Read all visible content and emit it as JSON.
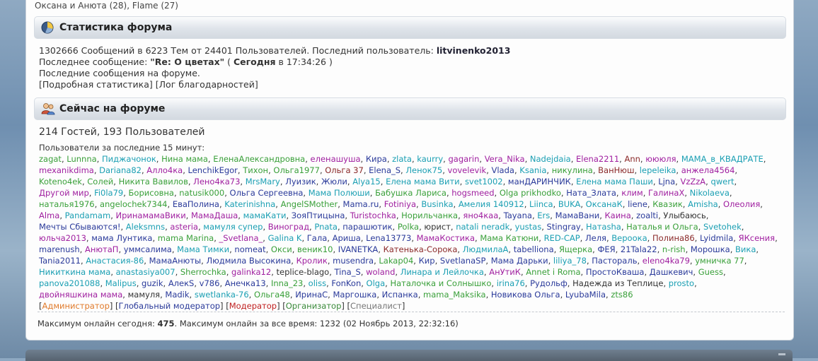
{
  "top_line": "Оксана и Анюта (28), Flame (27)",
  "stats_section": {
    "title": "Статистика форума",
    "icon": "pie-chart-icon",
    "line1_prefix": "1302666 Сообщений в 6223 Тем от 24401 Пользователей. Последний пользователь: ",
    "last_user": "litvinenko2013",
    "line2_prefix": "Последнее сообщение: ",
    "last_message": "\"Re: О цветах\"",
    "line2_mid": " ( ",
    "last_message_time_bold": "Сегодня",
    "line2_suffix": " в 17:34:26 )",
    "line3": "Последние сообщения на форуме.",
    "line4_link1": "[Подробная статистика]",
    "line4_link2": "[Лог благодарностей]"
  },
  "online_section": {
    "title": "Сейчас на форуме",
    "icon": "users-icon",
    "counts": "214 Гостей, 193 Пользователей",
    "users_label": "Пользователи за последние 15 минут:",
    "users": [
      {
        "n": "zagat",
        "c": "#3aa03a"
      },
      {
        "n": "Lunnna",
        "c": "#3aa03a"
      },
      {
        "n": "Пиджачонок",
        "c": "#1a9fb3"
      },
      {
        "n": "Нина мама",
        "c": "#3aa03a"
      },
      {
        "n": "ЕленаАлександровна",
        "c": "#3aa03a"
      },
      {
        "n": "еленашуша",
        "c": "#a020a0"
      },
      {
        "n": "Кира",
        "c": "#2a3a9a"
      },
      {
        "n": "zlata",
        "c": "#1a9fb3"
      },
      {
        "n": "kaurry",
        "c": "#1a9fb3"
      },
      {
        "n": "gagarin",
        "c": "#a020a0"
      },
      {
        "n": "Vera_Nika",
        "c": "#a020a0"
      },
      {
        "n": "Nadejdaia",
        "c": "#1a9fb3"
      },
      {
        "n": "Elena2211",
        "c": "#a020a0"
      },
      {
        "n": "Ann",
        "c": "#8b2a2a"
      },
      {
        "n": "юююля",
        "c": "#a020a0"
      },
      {
        "n": "МАМА_в_КВАДРАТЕ",
        "c": "#1a9fb3"
      },
      {
        "n": "mexanikdima",
        "c": "#a020a0"
      },
      {
        "n": "Dariana82",
        "c": "#1a9fb3"
      },
      {
        "n": "Алло4ка",
        "c": "#a020a0"
      },
      {
        "n": "LenchikEgor",
        "c": "#2a3a9a"
      },
      {
        "n": "Тихон",
        "c": "#3aa03a"
      },
      {
        "n": "Ольга1977",
        "c": "#3aa03a"
      },
      {
        "n": "Ольга 37",
        "c": "#8b2a2a"
      },
      {
        "n": "Elena_S",
        "c": "#2a3a9a"
      },
      {
        "n": "Ленок75",
        "c": "#1a9fb3"
      },
      {
        "n": "vovelevik",
        "c": "#a020a0"
      },
      {
        "n": "Vlada",
        "c": "#2a3a9a"
      },
      {
        "n": "Ksania",
        "c": "#1a9fb3"
      },
      {
        "n": "никулина",
        "c": "#3aa03a"
      },
      {
        "n": "ВанНюш",
        "c": "#8b2a2a"
      },
      {
        "n": "lepeleika",
        "c": "#1a9fb3"
      },
      {
        "n": "анжела4564",
        "c": "#a020a0"
      },
      {
        "n": "Koteno4ek",
        "c": "#3aa03a"
      },
      {
        "n": "Солей",
        "c": "#3aa03a"
      },
      {
        "n": "Никита Вавилов",
        "c": "#3aa03a"
      },
      {
        "n": "Лено4ка73",
        "c": "#a020a0"
      },
      {
        "n": "MrsMary",
        "c": "#1a9fb3"
      },
      {
        "n": "Луизик",
        "c": "#2a3a9a"
      },
      {
        "n": "Жюли",
        "c": "#2a3a9a"
      },
      {
        "n": "Alya15",
        "c": "#1a9fb3"
      },
      {
        "n": "Елена мама Вити",
        "c": "#1a9fb3"
      },
      {
        "n": "svet1002",
        "c": "#1a9fb3"
      },
      {
        "n": "манДАРИНЧИК",
        "c": "#2a3a9a"
      },
      {
        "n": "Елена мама Паши",
        "c": "#1a9fb3"
      },
      {
        "n": "Ljna",
        "c": "#2a3a9a"
      },
      {
        "n": "VzZzA",
        "c": "#a020a0"
      },
      {
        "n": "qwert",
        "c": "#1a9fb3"
      },
      {
        "n": "Другой мир",
        "c": "#a020a0"
      },
      {
        "n": "Fi0la79",
        "c": "#1a9fb3"
      },
      {
        "n": "Борисовна",
        "c": "#3aa03a"
      },
      {
        "n": "natusik000",
        "c": "#3aa03a"
      },
      {
        "n": "Ольга Сергеевна",
        "c": "#2a3a9a"
      },
      {
        "n": "Мама Полюши",
        "c": "#1a9fb3"
      },
      {
        "n": "Бабушка Лариса",
        "c": "#3aa03a"
      },
      {
        "n": "hogsmeed",
        "c": "#a020a0"
      },
      {
        "n": "Olga prikhodko",
        "c": "#3aa03a"
      },
      {
        "n": "Ната_Злата",
        "c": "#2a3a9a"
      },
      {
        "n": "клим",
        "c": "#a020a0"
      },
      {
        "n": "ГалинаХ",
        "c": "#a020a0"
      },
      {
        "n": "Nikolaeva",
        "c": "#1a9fb3"
      },
      {
        "n": "наталья1976",
        "c": "#3aa03a"
      },
      {
        "n": "angelochek7344",
        "c": "#3aa03a"
      },
      {
        "n": "ЕваПолина",
        "c": "#2a3a9a"
      },
      {
        "n": "Katerinishna",
        "c": "#1a9fb3"
      },
      {
        "n": "AngelSMother",
        "c": "#3aa03a"
      },
      {
        "n": "Mama.ru",
        "c": "#2a3a9a"
      },
      {
        "n": "Fotiniya",
        "c": "#a020a0"
      },
      {
        "n": "Businka",
        "c": "#1a9fb3"
      },
      {
        "n": "Амелия 140912",
        "c": "#1a9fb3"
      },
      {
        "n": "Liinca",
        "c": "#1a9fb3"
      },
      {
        "n": "BUKA",
        "c": "#1a9fb3"
      },
      {
        "n": "ОксанаК",
        "c": "#1a9fb3"
      },
      {
        "n": "liene",
        "c": "#2a3a9a"
      },
      {
        "n": "Квазик",
        "c": "#3aa03a"
      },
      {
        "n": "Amisha",
        "c": "#1a9fb3"
      },
      {
        "n": "Олеолия",
        "c": "#a020a0"
      },
      {
        "n": "Alma",
        "c": "#a020a0"
      },
      {
        "n": "Pandamam",
        "c": "#1a9fb3"
      },
      {
        "n": "ИринамамаВики",
        "c": "#a020a0"
      },
      {
        "n": "МамаДаша",
        "c": "#a020a0"
      },
      {
        "n": "мамаКати",
        "c": "#1a9fb3"
      },
      {
        "n": "ЗояПтицына",
        "c": "#2a3a9a"
      },
      {
        "n": "Turistochka",
        "c": "#a020a0"
      },
      {
        "n": "Норильчанка",
        "c": "#3aa03a"
      },
      {
        "n": "яно4каа",
        "c": "#a020a0"
      },
      {
        "n": "Tayana",
        "c": "#2a3a9a"
      },
      {
        "n": "Ers",
        "c": "#1a9fb3"
      },
      {
        "n": "МамаВани",
        "c": "#2a3a9a"
      },
      {
        "n": "Каина",
        "c": "#a020a0"
      },
      {
        "n": "zoalti",
        "c": "#2a3a9a"
      },
      {
        "n": "Улыбаюсь",
        "c": "#333333"
      },
      {
        "n": "Мечты Сбываются!",
        "c": "#2a3a9a"
      },
      {
        "n": "Aleksmns",
        "c": "#1a9fb3"
      },
      {
        "n": "asteria",
        "c": "#a020a0"
      },
      {
        "n": "мамуля супер",
        "c": "#1a9fb3"
      },
      {
        "n": "Виноград",
        "c": "#a020a0"
      },
      {
        "n": "Pnata",
        "c": "#1a9fb3"
      },
      {
        "n": "парашютик",
        "c": "#2a3a9a"
      },
      {
        "n": "Polka",
        "c": "#3aa03a"
      },
      {
        "n": "юрист",
        "c": "#333333"
      },
      {
        "n": "natali neradk",
        "c": "#1a9fb3"
      },
      {
        "n": "yustas",
        "c": "#1a9fb3"
      },
      {
        "n": "Stingray",
        "c": "#2a3a9a"
      },
      {
        "n": "Натаsha",
        "c": "#1a9fb3"
      },
      {
        "n": "Наталья и Ольга",
        "c": "#3aa03a"
      },
      {
        "n": "Svetohek",
        "c": "#1a9fb3"
      },
      {
        "n": "юльча2013",
        "c": "#a020a0"
      },
      {
        "n": "мама Лунтика",
        "c": "#2a3a9a"
      },
      {
        "n": "mama Marina",
        "c": "#3aa03a"
      },
      {
        "n": "_Svetlana_",
        "c": "#a020a0"
      },
      {
        "n": "Galina K",
        "c": "#1a9fb3"
      },
      {
        "n": "Гала",
        "c": "#2a3a9a"
      },
      {
        "n": "Ариша",
        "c": "#2a3a9a"
      },
      {
        "n": "Lena13773",
        "c": "#2a3a9a"
      },
      {
        "n": "МамаКостика",
        "c": "#a020a0"
      },
      {
        "n": "Мама Катюни",
        "c": "#3aa03a"
      },
      {
        "n": "RED-CAP",
        "c": "#1a9fb3"
      },
      {
        "n": "Леля",
        "c": "#2a3a9a"
      },
      {
        "n": "Вероока",
        "c": "#1a9fb3"
      },
      {
        "n": "Полина86",
        "c": "#8b2a2a"
      },
      {
        "n": "Lyidmila",
        "c": "#2a3a9a"
      },
      {
        "n": "ЯКсения",
        "c": "#a020a0"
      },
      {
        "n": "marenush",
        "c": "#2a3a9a"
      },
      {
        "n": "АнютаП",
        "c": "#a020a0"
      },
      {
        "n": "уммсалима",
        "c": "#2a3a9a"
      },
      {
        "n": "Мама Тимки",
        "c": "#1a9fb3"
      },
      {
        "n": "nomeat",
        "c": "#2a3a9a"
      },
      {
        "n": "Окси",
        "c": "#3aa03a"
      },
      {
        "n": "веник10",
        "c": "#3aa03a"
      },
      {
        "n": "IVANETKA",
        "c": "#2a3a9a"
      },
      {
        "n": "Катенька-Сорока",
        "c": "#8b2a2a"
      },
      {
        "n": "ЛюдмилаА",
        "c": "#1a9fb3"
      },
      {
        "n": "tabelliona",
        "c": "#2a3a9a"
      },
      {
        "n": "Ящерка",
        "c": "#3aa03a"
      },
      {
        "n": "ФЕЯ",
        "c": "#2a3a9a"
      },
      {
        "n": "21Tala22",
        "c": "#2a3a9a"
      },
      {
        "n": "n-rish",
        "c": "#3aa03a"
      },
      {
        "n": "Морошка",
        "c": "#2a3a9a"
      },
      {
        "n": "Вика",
        "c": "#1a9fb3"
      },
      {
        "n": "Tania2011",
        "c": "#2a3a9a"
      },
      {
        "n": "Анастасия-86",
        "c": "#1a9fb3"
      },
      {
        "n": "МамаАнюты",
        "c": "#2a3a9a"
      },
      {
        "n": "Людмила Высокина",
        "c": "#2a3a9a"
      },
      {
        "n": "Кролик",
        "c": "#a020a0"
      },
      {
        "n": "musendra",
        "c": "#2a3a9a"
      },
      {
        "n": "Lakap04",
        "c": "#3aa03a"
      },
      {
        "n": "Кир",
        "c": "#2a3a9a"
      },
      {
        "n": "SvetlanaSP",
        "c": "#2a3a9a"
      },
      {
        "n": "Мама Дарьки",
        "c": "#2a3a9a"
      },
      {
        "n": "liliya_78",
        "c": "#1a9fb3"
      },
      {
        "n": "Пастораль",
        "c": "#2a3a9a"
      },
      {
        "n": "eleno4ka79",
        "c": "#a020a0"
      },
      {
        "n": "умничка 77",
        "c": "#3aa03a"
      },
      {
        "n": "Никиткина мама",
        "c": "#1a9fb3"
      },
      {
        "n": "anastasiya007",
        "c": "#1a9fb3"
      },
      {
        "n": "Sherrochka",
        "c": "#3aa03a"
      },
      {
        "n": "galinka12",
        "c": "#a020a0"
      },
      {
        "n": "teplice-blago",
        "c": "#333333"
      },
      {
        "n": "Tina_S",
        "c": "#2a3a9a"
      },
      {
        "n": "woland",
        "c": "#a020a0"
      },
      {
        "n": "Линара и Лейлочка",
        "c": "#1a9fb3"
      },
      {
        "n": "АнУтиК",
        "c": "#a020a0"
      },
      {
        "n": "Annet i Roma",
        "c": "#3aa03a"
      },
      {
        "n": "ПростоКваша",
        "c": "#2a3a9a"
      },
      {
        "n": "Дашкевич",
        "c": "#2a3a9a"
      },
      {
        "n": "Guess",
        "c": "#3aa03a"
      },
      {
        "n": "panova201088",
        "c": "#1a9fb3"
      },
      {
        "n": "Malipus",
        "c": "#1a9fb3"
      },
      {
        "n": "guzik",
        "c": "#2a3a9a"
      },
      {
        "n": "АлекS",
        "c": "#2a3a9a"
      },
      {
        "n": "v786",
        "c": "#2a3a9a"
      },
      {
        "n": "Анечка13",
        "c": "#2a3a9a"
      },
      {
        "n": "Inna_23",
        "c": "#3aa03a"
      },
      {
        "n": "oliss",
        "c": "#1a9fb3"
      },
      {
        "n": "FonKon",
        "c": "#2a3a9a"
      },
      {
        "n": "Olga",
        "c": "#1a9fb3"
      },
      {
        "n": "Наталочка и Солнышко",
        "c": "#3aa03a"
      },
      {
        "n": "irina76",
        "c": "#1a9fb3"
      },
      {
        "n": "Рудольф",
        "c": "#2a3a9a"
      },
      {
        "n": "Надежда из Теплице",
        "c": "#333333"
      },
      {
        "n": "prosto",
        "c": "#1a9fb3"
      },
      {
        "n": "двойняшкина мама",
        "c": "#a020a0"
      },
      {
        "n": "мамуля",
        "c": "#333333"
      },
      {
        "n": "Madik",
        "c": "#2a3a9a"
      },
      {
        "n": "swetlanka-76",
        "c": "#1a9fb3"
      },
      {
        "n": "Ольга48",
        "c": "#3aa03a"
      },
      {
        "n": "ИринаС",
        "c": "#2a3a9a"
      },
      {
        "n": "Маргошка",
        "c": "#2a3a9a"
      },
      {
        "n": "Испанка",
        "c": "#2a3a9a"
      },
      {
        "n": "mama_Maksika",
        "c": "#3aa03a"
      },
      {
        "n": "Новикова Ольга",
        "c": "#2a3a9a"
      },
      {
        "n": "LyubaMila",
        "c": "#2a3a9a"
      },
      {
        "n": "zts86",
        "c": "#3aa03a"
      }
    ],
    "legend": [
      {
        "label": "Администратор",
        "c": "#e07a2a"
      },
      {
        "label": "Глобальный модератор",
        "c": "#2a3a9a"
      },
      {
        "label": "Модератор",
        "c": "#c02020"
      },
      {
        "label": "Организатор",
        "c": "#3a8a3a"
      },
      {
        "label": "Специалист",
        "c": "#777777"
      }
    ],
    "max_prefix": "Максимум онлайн сегодня: ",
    "max_today": "475",
    "max_suffix": ". Максимум онлайн за все время: 1232 (02 Ноябрь 2013, 22:32:16)"
  }
}
